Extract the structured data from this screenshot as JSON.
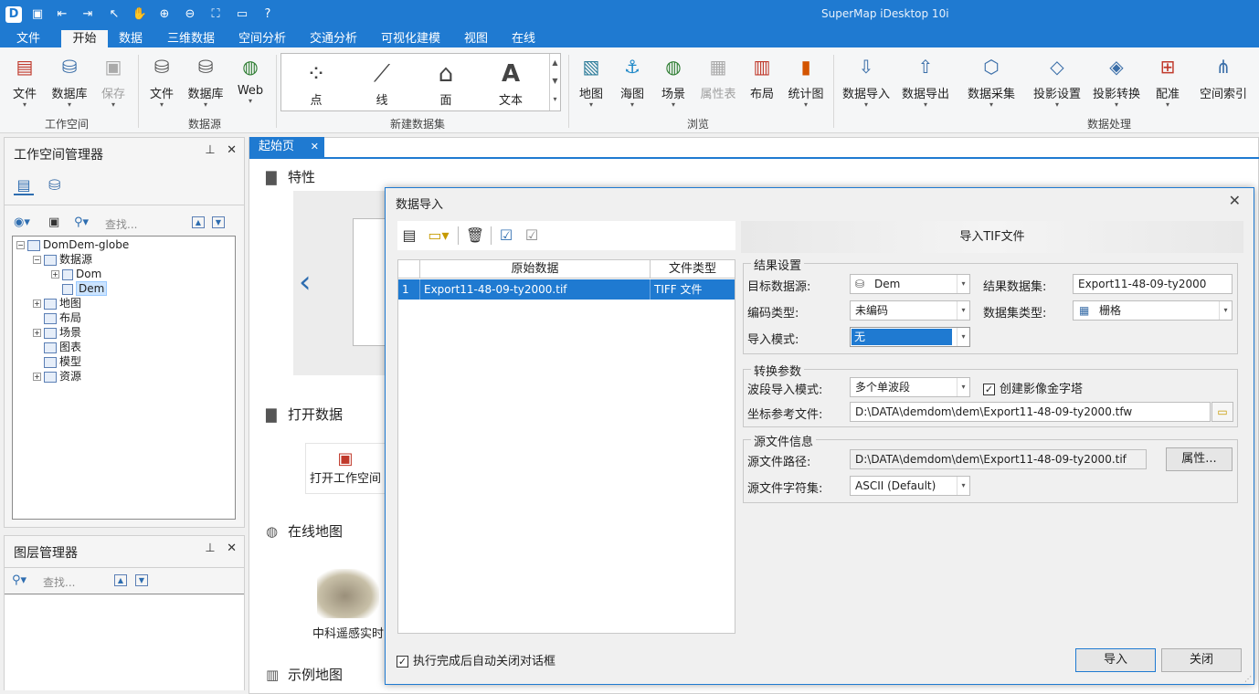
{
  "app": {
    "title": "SuperMap iDesktop 10i"
  },
  "quick_access": [
    "app-logo-icon",
    "save-icon",
    "back-icon",
    "forward-icon",
    "pointer-icon",
    "pan-icon",
    "zoom-in-icon",
    "zoom-out-icon",
    "full-extent-icon",
    "open-folder-icon",
    "help-icon"
  ],
  "menu": [
    "文件",
    "开始",
    "数据",
    "三维数据",
    "空间分析",
    "交通分析",
    "可视化建模",
    "视图",
    "在线"
  ],
  "ribbon": {
    "workspace": {
      "group": "工作空间",
      "file": "文件",
      "database": "数据库",
      "save": "保存"
    },
    "datasource": {
      "group": "数据源",
      "file": "文件",
      "database": "数据库",
      "web": "Web"
    },
    "new_dataset": {
      "group": "新建数据集",
      "point": "点",
      "line": "线",
      "region": "面",
      "text": "文本"
    },
    "browse": {
      "group": "浏览",
      "map": "地图",
      "chart": "海图",
      "scene": "场景",
      "attr_table": "属性表",
      "layout": "布局",
      "stat_chart": "统计图"
    },
    "data_processing": {
      "group": "数据处理",
      "import": "数据导入",
      "export": "数据导出",
      "collect": "数据采集",
      "proj_set": "投影设置",
      "proj_trans": "投影转换",
      "register": "配准",
      "spatial_index": "空间索引"
    }
  },
  "workspace_panel": {
    "title": "工作空间管理器",
    "search_placeholder": "查找...",
    "tree": {
      "root": "DomDem-globe",
      "datasources": "数据源",
      "ds1": "Dom",
      "ds2": "Dem",
      "maps": "地图",
      "layouts": "布局",
      "scenes": "场景",
      "charts": "图表",
      "models": "模型",
      "resources": "资源"
    }
  },
  "layer_panel": {
    "title": "图层管理器",
    "search_placeholder": "查找..."
  },
  "doc": {
    "tab": "起始页",
    "sections": {
      "features": "特性",
      "open_data": "打开数据",
      "online_map": "在线地图",
      "sample_map": "示例地图"
    },
    "open_workspace": "打开工作空间",
    "online_item": "中科遥感实时"
  },
  "dialog": {
    "title": "数据导入",
    "grid": {
      "col_source": "原始数据",
      "col_type": "文件类型",
      "rows": [
        {
          "index": "1",
          "name": "Export11-48-09-ty2000.tif",
          "type": "TIFF 文件"
        }
      ]
    },
    "right_title": "导入TIF文件",
    "result": {
      "legend": "结果设置",
      "target_ds_label": "目标数据源:",
      "target_ds": "Dem",
      "result_dataset_label": "结果数据集:",
      "result_dataset": "Export11-48-09-ty2000",
      "encode_label": "编码类型:",
      "encode": "未编码",
      "dataset_type_label": "数据集类型:",
      "dataset_type": "栅格",
      "import_mode_label": "导入模式:",
      "import_mode": "无"
    },
    "convert": {
      "legend": "转换参数",
      "band_label": "波段导入模式:",
      "band": "多个单波段",
      "pyramid_label": "创建影像金字塔",
      "pyramid_checked": true,
      "coord_label": "坐标参考文件:",
      "coord": "D:\\DATA\\demdom\\dem\\Export11-48-09-ty2000.tfw"
    },
    "source": {
      "legend": "源文件信息",
      "path_label": "源文件路径:",
      "path": "D:\\DATA\\demdom\\dem\\Export11-48-09-ty2000.tif",
      "props_button": "属性...",
      "charset_label": "源文件字符集:",
      "charset": "ASCII (Default)"
    },
    "auto_close_label": "执行完成后自动关闭对话框",
    "auto_close_checked": true,
    "import_button": "导入",
    "close_button": "关闭"
  }
}
